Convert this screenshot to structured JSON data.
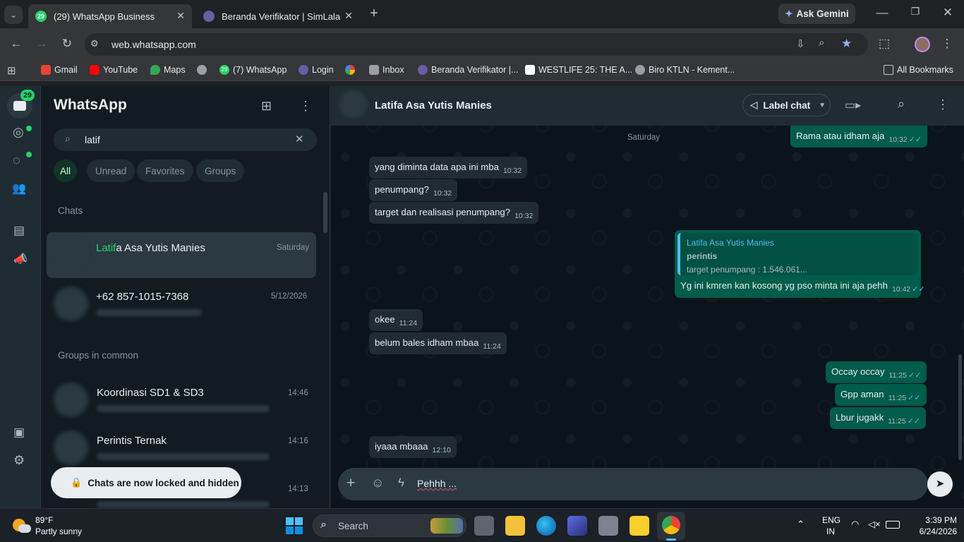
{
  "browser": {
    "tabs": [
      {
        "label": "(29) WhatsApp Business",
        "favicon_badge": "29"
      },
      {
        "label": "Beranda Verifikator | SimLala"
      }
    ],
    "ask_gemini": "Ask Gemini",
    "url": "web.whatsapp.com",
    "bookmarks": [
      "Gmail",
      "YouTube",
      "Maps",
      "(7) WhatsApp",
      "Login",
      "Inbox",
      "Beranda Verifikator |...",
      "WESTLIFE 25: THE A...",
      "Biro KTLN - Kement...",
      "All Bookmarks"
    ],
    "bookmark_badge": "29"
  },
  "whatsapp": {
    "nav_badge": "29",
    "title": "WhatsApp",
    "search_value": "latif",
    "filters": [
      "All",
      "Unread",
      "Favorites",
      "Groups"
    ],
    "chats_header": "Chats",
    "chats": [
      {
        "name_highlight": "Latif",
        "name_rest": "a Asa Yutis Manies",
        "time": "Saturday"
      },
      {
        "name": "+62 857-1015-7368",
        "time": "5/12/2026"
      }
    ],
    "groups_header": "Groups in common",
    "groups": [
      {
        "name": "Koordinasi SD1 & SD3",
        "time": "14:46"
      },
      {
        "name": "Perintis Ternak",
        "time": "14:16"
      },
      {
        "time": "14:13"
      }
    ],
    "toast": "Chats are now locked and hidden",
    "chat_header_name": "Latifa Asa Yutis Manies",
    "label_chat": "Label chat",
    "day_separator": "Saturday",
    "messages": [
      {
        "dir": "out",
        "text": "Rama atau idham aja",
        "time": "10:32"
      },
      {
        "dir": "in",
        "text": "yang diminta data apa ini mba",
        "time": "10:32"
      },
      {
        "dir": "in",
        "text": "penumpang?",
        "time": "10:32"
      },
      {
        "dir": "in",
        "text": "target dan realisasi penumpang?",
        "time": "10:32"
      },
      {
        "dir": "out",
        "quote_name": "Latifa Asa Yutis Manies",
        "quote_title": "perintis",
        "quote_text": "target penumpang : 1.546.061...",
        "text": "Yg ini kmren kan kosong yg pso minta ini aja pehh",
        "time": "10:42"
      },
      {
        "dir": "in",
        "text": "okee",
        "time": "11:24"
      },
      {
        "dir": "in",
        "text": "belum bales idham mbaa",
        "time": "11:24"
      },
      {
        "dir": "out",
        "text": "Occay occay",
        "time": "11:25"
      },
      {
        "dir": "out",
        "text": "Gpp aman",
        "time": "11:25"
      },
      {
        "dir": "out",
        "text": "Lbur jugakk",
        "time": "11:25"
      },
      {
        "dir": "in",
        "text": "iyaaa mbaaa",
        "time": "12:10"
      }
    ],
    "composer_value": "Pehhh ..."
  },
  "taskbar": {
    "weather_temp": "89°F",
    "weather_desc": "Partly sunny",
    "search_label": "Search",
    "lang_top": "ENG",
    "lang_bottom": "IN",
    "time": "3:39 PM",
    "date": "6/24/2026"
  }
}
